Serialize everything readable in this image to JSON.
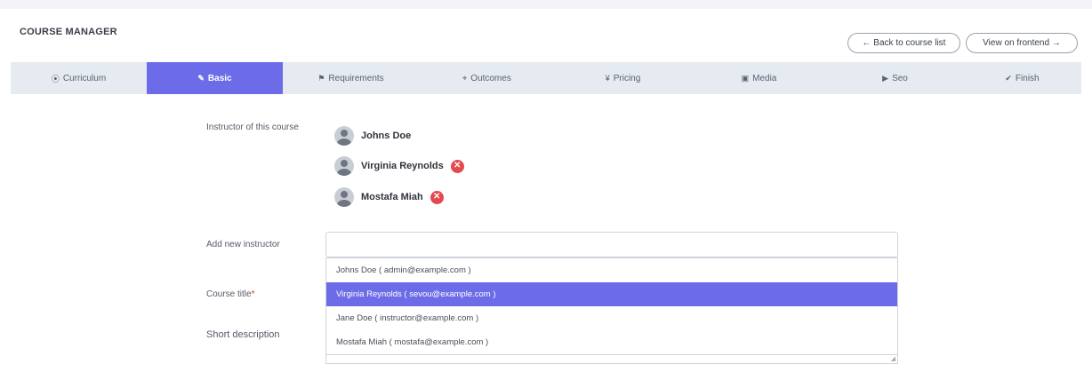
{
  "header": {
    "title": "COURSE MANAGER",
    "back_label": "← Back to course list",
    "frontend_label": "View on frontend →"
  },
  "tabs": [
    {
      "label": "Curriculum",
      "icon": "curriculum-icon",
      "glyph": "⦿",
      "active": false
    },
    {
      "label": "Basic",
      "icon": "pencil-icon",
      "glyph": "✎",
      "active": true
    },
    {
      "label": "Requirements",
      "icon": "bell-icon",
      "glyph": "⚑",
      "active": false
    },
    {
      "label": "Outcomes",
      "icon": "crosshair-icon",
      "glyph": "⌖",
      "active": false
    },
    {
      "label": "Pricing",
      "icon": "yen-icon",
      "glyph": "¥",
      "active": false
    },
    {
      "label": "Media",
      "icon": "media-icon",
      "glyph": "▣",
      "active": false
    },
    {
      "label": "Seo",
      "icon": "tag-icon",
      "glyph": "▶",
      "active": false
    },
    {
      "label": "Finish",
      "icon": "check-circle-icon",
      "glyph": "✔",
      "active": false
    }
  ],
  "form": {
    "instructor_label": "Instructor of this course",
    "instructors": [
      {
        "name": "Johns Doe",
        "removable": false
      },
      {
        "name": "Virginia Reynolds",
        "removable": true
      },
      {
        "name": "Mostafa Miah",
        "removable": true
      }
    ],
    "add_instructor_label": "Add new instructor",
    "add_instructor_value": "",
    "course_title_label": "Course title",
    "course_title_required": "*",
    "short_description_label": "Short description",
    "dropdown_options": [
      {
        "label": "Johns Doe ( admin@example.com )",
        "selected": false
      },
      {
        "label": "Virginia Reynolds ( sevou@example.com )",
        "selected": true
      },
      {
        "label": "Jane Doe ( instructor@example.com )",
        "selected": false
      },
      {
        "label": "Mostafa Miah ( mostafa@example.com )",
        "selected": false
      }
    ],
    "remove_glyph": "✕"
  },
  "colors": {
    "accent": "#6c6ce8",
    "tab_bar": "#e6ebf1",
    "remove": "#e5484d"
  }
}
